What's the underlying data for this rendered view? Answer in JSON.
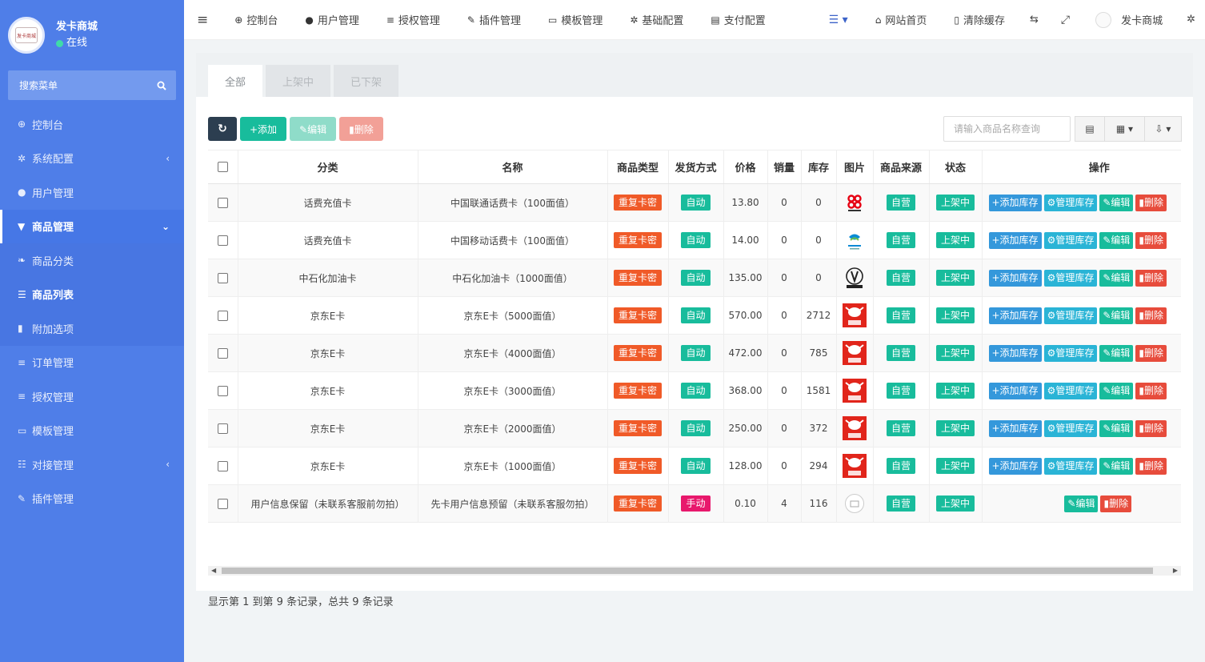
{
  "sidebar": {
    "user_name": "发卡商城",
    "status": "在线",
    "avatar_text": "发卡商城",
    "search_label": "搜索菜单",
    "items": [
      {
        "label": "控制台",
        "icon": "dashboard-icon",
        "glyph": "⊕",
        "arrow": ""
      },
      {
        "label": "系统配置",
        "icon": "gear-icon",
        "glyph": "✲",
        "arrow": "‹"
      },
      {
        "label": "用户管理",
        "icon": "user-icon",
        "glyph": "●",
        "arrow": ""
      },
      {
        "label": "商品管理",
        "icon": "cart-icon",
        "glyph": "▼",
        "arrow": "⌄"
      },
      {
        "label": "商品分类",
        "icon": "leaf-icon",
        "glyph": "❧",
        "arrow": ""
      },
      {
        "label": "商品列表",
        "icon": "list-icon",
        "glyph": "☰",
        "arrow": ""
      },
      {
        "label": "附加选项",
        "icon": "bookmark-icon",
        "glyph": "▮",
        "arrow": ""
      },
      {
        "label": "订单管理",
        "icon": "bars-icon",
        "glyph": "≡",
        "arrow": ""
      },
      {
        "label": "授权管理",
        "icon": "bars-icon",
        "glyph": "≡",
        "arrow": ""
      },
      {
        "label": "模板管理",
        "icon": "template-icon",
        "glyph": "▭",
        "arrow": ""
      },
      {
        "label": "对接管理",
        "icon": "sliders-icon",
        "glyph": "☷",
        "arrow": "‹"
      },
      {
        "label": "插件管理",
        "icon": "plugin-icon",
        "glyph": "✎",
        "arrow": ""
      }
    ]
  },
  "topbar": {
    "menu_glyph": "≡",
    "nav": [
      {
        "label": "控制台",
        "glyph": "⊕",
        "icon": "dashboard-icon"
      },
      {
        "label": "用户管理",
        "glyph": "●",
        "icon": "user-icon"
      },
      {
        "label": "授权管理",
        "glyph": "≡",
        "icon": "bars-icon"
      },
      {
        "label": "插件管理",
        "glyph": "✎",
        "icon": "plugin-icon"
      },
      {
        "label": "模板管理",
        "glyph": "▭",
        "icon": "template-icon"
      },
      {
        "label": "基础配置",
        "glyph": "✲",
        "icon": "gear-icon"
      },
      {
        "label": "支付配置",
        "glyph": "▤",
        "icon": "payment-icon"
      }
    ],
    "right": [
      {
        "label": "网站首页",
        "glyph": "⌂",
        "icon": "home-icon"
      },
      {
        "label": "清除缓存",
        "glyph": "▯",
        "icon": "trash-icon"
      }
    ],
    "dropdown_glyph": "☰ ▾",
    "lang_glyph": "⇆",
    "fullscreen_glyph": "⤢",
    "user_name": "发卡商城",
    "settings_glyph": "✲"
  },
  "tabs": [
    "全部",
    "上架中",
    "已下架"
  ],
  "toolbar": {
    "refresh_glyph": "↻",
    "add": "+添加",
    "edit": "✎编辑",
    "delete": "▮删除"
  },
  "search": {
    "placeholder": "请输入商品名称查询"
  },
  "tools": {
    "columns_glyph": "▤",
    "grid_glyph": "▦ ▾",
    "export_glyph": "⇩ ▾"
  },
  "table": {
    "headers": [
      "分类",
      "名称",
      "商品类型",
      "发货方式",
      "价格",
      "销量",
      "库存",
      "图片",
      "商品来源",
      "状态",
      "操作"
    ],
    "ops": {
      "add_stock": "+添加库存",
      "manage_stock": "⚙管理库存",
      "edit": "✎编辑",
      "delete": "▮删除"
    },
    "rows": [
      {
        "category": "话费充值卡",
        "name": "中国联通话费卡（100面值）",
        "type": "重复卡密",
        "delivery": "自动",
        "price": "13.80",
        "sales": "0",
        "stock": "0",
        "image": "unicom",
        "source": "自营",
        "status": "上架中",
        "full_ops": true
      },
      {
        "category": "话费充值卡",
        "name": "中国移动话费卡（100面值）",
        "type": "重复卡密",
        "delivery": "自动",
        "price": "14.00",
        "sales": "0",
        "stock": "0",
        "image": "mobile",
        "source": "自营",
        "status": "上架中",
        "full_ops": true
      },
      {
        "category": "中石化加油卡",
        "name": "中石化加油卡（1000面值）",
        "type": "重复卡密",
        "delivery": "自动",
        "price": "135.00",
        "sales": "0",
        "stock": "0",
        "image": "sinopec",
        "source": "自营",
        "status": "上架中",
        "full_ops": true
      },
      {
        "category": "京东E卡",
        "name": "京东E卡（5000面值）",
        "type": "重复卡密",
        "delivery": "自动",
        "price": "570.00",
        "sales": "0",
        "stock": "2712",
        "image": "jd",
        "source": "自营",
        "status": "上架中",
        "full_ops": true
      },
      {
        "category": "京东E卡",
        "name": "京东E卡（4000面值）",
        "type": "重复卡密",
        "delivery": "自动",
        "price": "472.00",
        "sales": "0",
        "stock": "785",
        "image": "jd",
        "source": "自营",
        "status": "上架中",
        "full_ops": true
      },
      {
        "category": "京东E卡",
        "name": "京东E卡（3000面值）",
        "type": "重复卡密",
        "delivery": "自动",
        "price": "368.00",
        "sales": "0",
        "stock": "1581",
        "image": "jd",
        "source": "自营",
        "status": "上架中",
        "full_ops": true
      },
      {
        "category": "京东E卡",
        "name": "京东E卡（2000面值）",
        "type": "重复卡密",
        "delivery": "自动",
        "price": "250.00",
        "sales": "0",
        "stock": "372",
        "image": "jd",
        "source": "自营",
        "status": "上架中",
        "full_ops": true
      },
      {
        "category": "京东E卡",
        "name": "京东E卡（1000面值）",
        "type": "重复卡密",
        "delivery": "自动",
        "price": "128.00",
        "sales": "0",
        "stock": "294",
        "image": "jd",
        "source": "自营",
        "status": "上架中",
        "full_ops": true
      },
      {
        "category": "用户信息保留（未联系客服前勿拍）",
        "name": "先卡用户信息预留（未联系客服勿拍）",
        "type": "重复卡密",
        "delivery": "手动",
        "price": "0.10",
        "sales": "4",
        "stock": "116",
        "image": "generic",
        "source": "自营",
        "status": "上架中",
        "full_ops": false
      }
    ]
  },
  "pager": {
    "summary": "显示第 1 到第 9 条记录，总共 9 条记录"
  },
  "colors": {
    "sidebar": "#4f7ee8",
    "orange": "#f05a28",
    "teal": "#18bc9c",
    "pink": "#e8186c",
    "blue": "#3498db",
    "red": "#e74c3c"
  }
}
